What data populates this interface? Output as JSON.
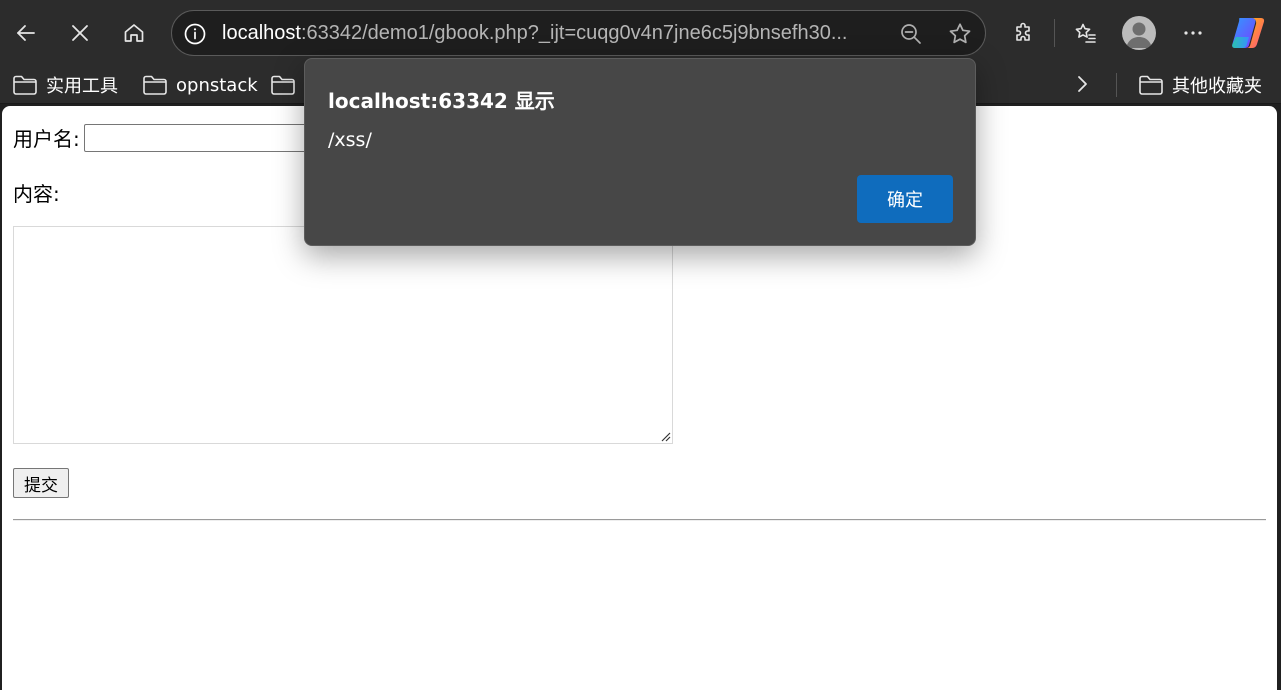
{
  "toolbar": {
    "url_host": "localhost",
    "url_rest": ":63342/demo1/gbook.php?_ijt=cuqg0v4n7jne6c5j9bnsefh30..."
  },
  "icons": {
    "back": "back-arrow-icon",
    "stop": "stop-icon",
    "home": "home-icon",
    "info": "info-icon",
    "zoom": "zoom-out-icon",
    "star": "star-icon",
    "extensions": "puzzle-icon",
    "favorites": "favorites-icon",
    "profile": "avatar",
    "more": "more-icon",
    "copilot": "copilot-icon",
    "folder": "folder-icon",
    "chevron": "chevron-right-icon"
  },
  "bookmarks": {
    "items": [
      {
        "label": "实用工具"
      },
      {
        "label": "opnstack"
      },
      {
        "label": ""
      }
    ],
    "other_label": "其他收藏夹"
  },
  "form": {
    "username_label": "用户名:",
    "username_value": "",
    "content_label": "内容:",
    "content_value": "",
    "submit_label": "提交"
  },
  "dialog": {
    "title": "localhost:63342 显示",
    "message": "/xss/",
    "ok_label": "确定"
  },
  "colors": {
    "toolbar_bg": "#2c2c2c",
    "dialog_bg": "#474747",
    "primary_button": "#0f6cbd",
    "page_bg": "#ffffff"
  }
}
